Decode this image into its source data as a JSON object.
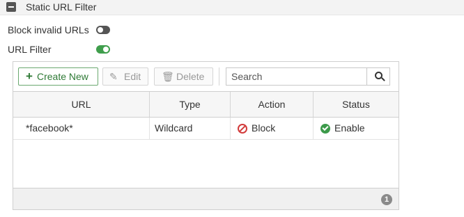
{
  "section": {
    "title": "Static URL Filter",
    "collapse_icon": "minus-square-icon"
  },
  "settings": {
    "block_invalid_urls": {
      "label": "Block invalid URLs",
      "enabled": false
    },
    "url_filter": {
      "label": "URL Filter",
      "enabled": true
    }
  },
  "toolbar": {
    "create_label": "Create New",
    "edit_label": "Edit",
    "delete_label": "Delete",
    "search_placeholder": "Search"
  },
  "table": {
    "columns": [
      "URL",
      "Type",
      "Action",
      "Status"
    ],
    "rows": [
      {
        "url": "*facebook*",
        "type": "Wildcard",
        "action": "Block",
        "status": "Enable"
      }
    ]
  },
  "footer": {
    "count": "1"
  },
  "colors": {
    "enabled_green": "#3f9e4c",
    "block_red": "#d23a3a",
    "toggle_off": "#555555"
  }
}
